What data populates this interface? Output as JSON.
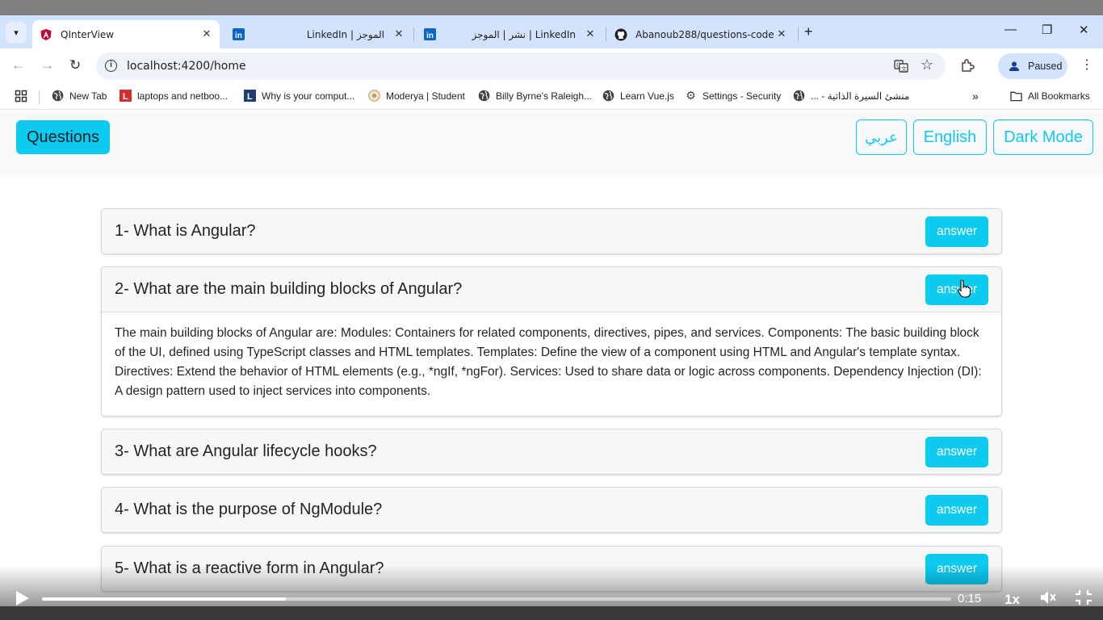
{
  "browser": {
    "tabs": [
      {
        "title": "QInterView",
        "icon": "angular-icon",
        "active": true
      },
      {
        "title": "LinkedIn | الموجز",
        "icon": "linkedin-icon"
      },
      {
        "title": "نشر | الموجز | LinkedIn",
        "icon": "linkedin-icon"
      },
      {
        "title": "Abanoub288/questions-code",
        "icon": "github-icon"
      }
    ],
    "url": "localhost:4200/home",
    "profile_label": "Paused",
    "bookmarks": [
      {
        "label": "New Tab",
        "icon": "globe-icon"
      },
      {
        "label": "laptops and netboo...",
        "icon": "l-logo-icon"
      },
      {
        "label": "Why is your comput...",
        "icon": "l-logo-icon"
      },
      {
        "label": "Moderya | Student",
        "icon": "moderya-icon"
      },
      {
        "label": "Billy Byrne's Raleigh...",
        "icon": "globe-icon"
      },
      {
        "label": "Learn Vue.js",
        "icon": "globe-icon"
      },
      {
        "label": "Settings - Security",
        "icon": "gear-icon"
      },
      {
        "label": "منشئ السيرة الذاتية - ...",
        "icon": "globe-icon"
      }
    ],
    "all_bookmarks_label": "All Bookmarks"
  },
  "app": {
    "brand": "Questions",
    "nav_buttons": {
      "arabic": "عربي",
      "english": "English",
      "dark_mode": "Dark Mode"
    },
    "accent_color": "#0dcaf0",
    "answer_label": "answer",
    "questions": [
      {
        "text": "1- What is Angular?",
        "expanded": false
      },
      {
        "text": "2- What are the main building blocks of Angular?",
        "expanded": true,
        "answer": "The main building blocks of Angular are: Modules: Containers for related components, directives, pipes, and services. Components: The basic building block of the UI, defined using TypeScript classes and HTML templates. Templates: Define the view of a component using HTML and Angular's template syntax. Directives: Extend the behavior of HTML elements (e.g., *ngIf, *ngFor). Services: Used to share data or logic across components. Dependency Injection (DI): A design pattern used to inject services into components."
      },
      {
        "text": "3- What are Angular lifecycle hooks?",
        "expanded": false
      },
      {
        "text": "4- What is the purpose of NgModule?",
        "expanded": false
      },
      {
        "text": "5- What is a reactive form in Angular?",
        "expanded": false
      }
    ]
  },
  "video": {
    "time": "0:15",
    "speed": "1x",
    "progress": 0.268
  }
}
